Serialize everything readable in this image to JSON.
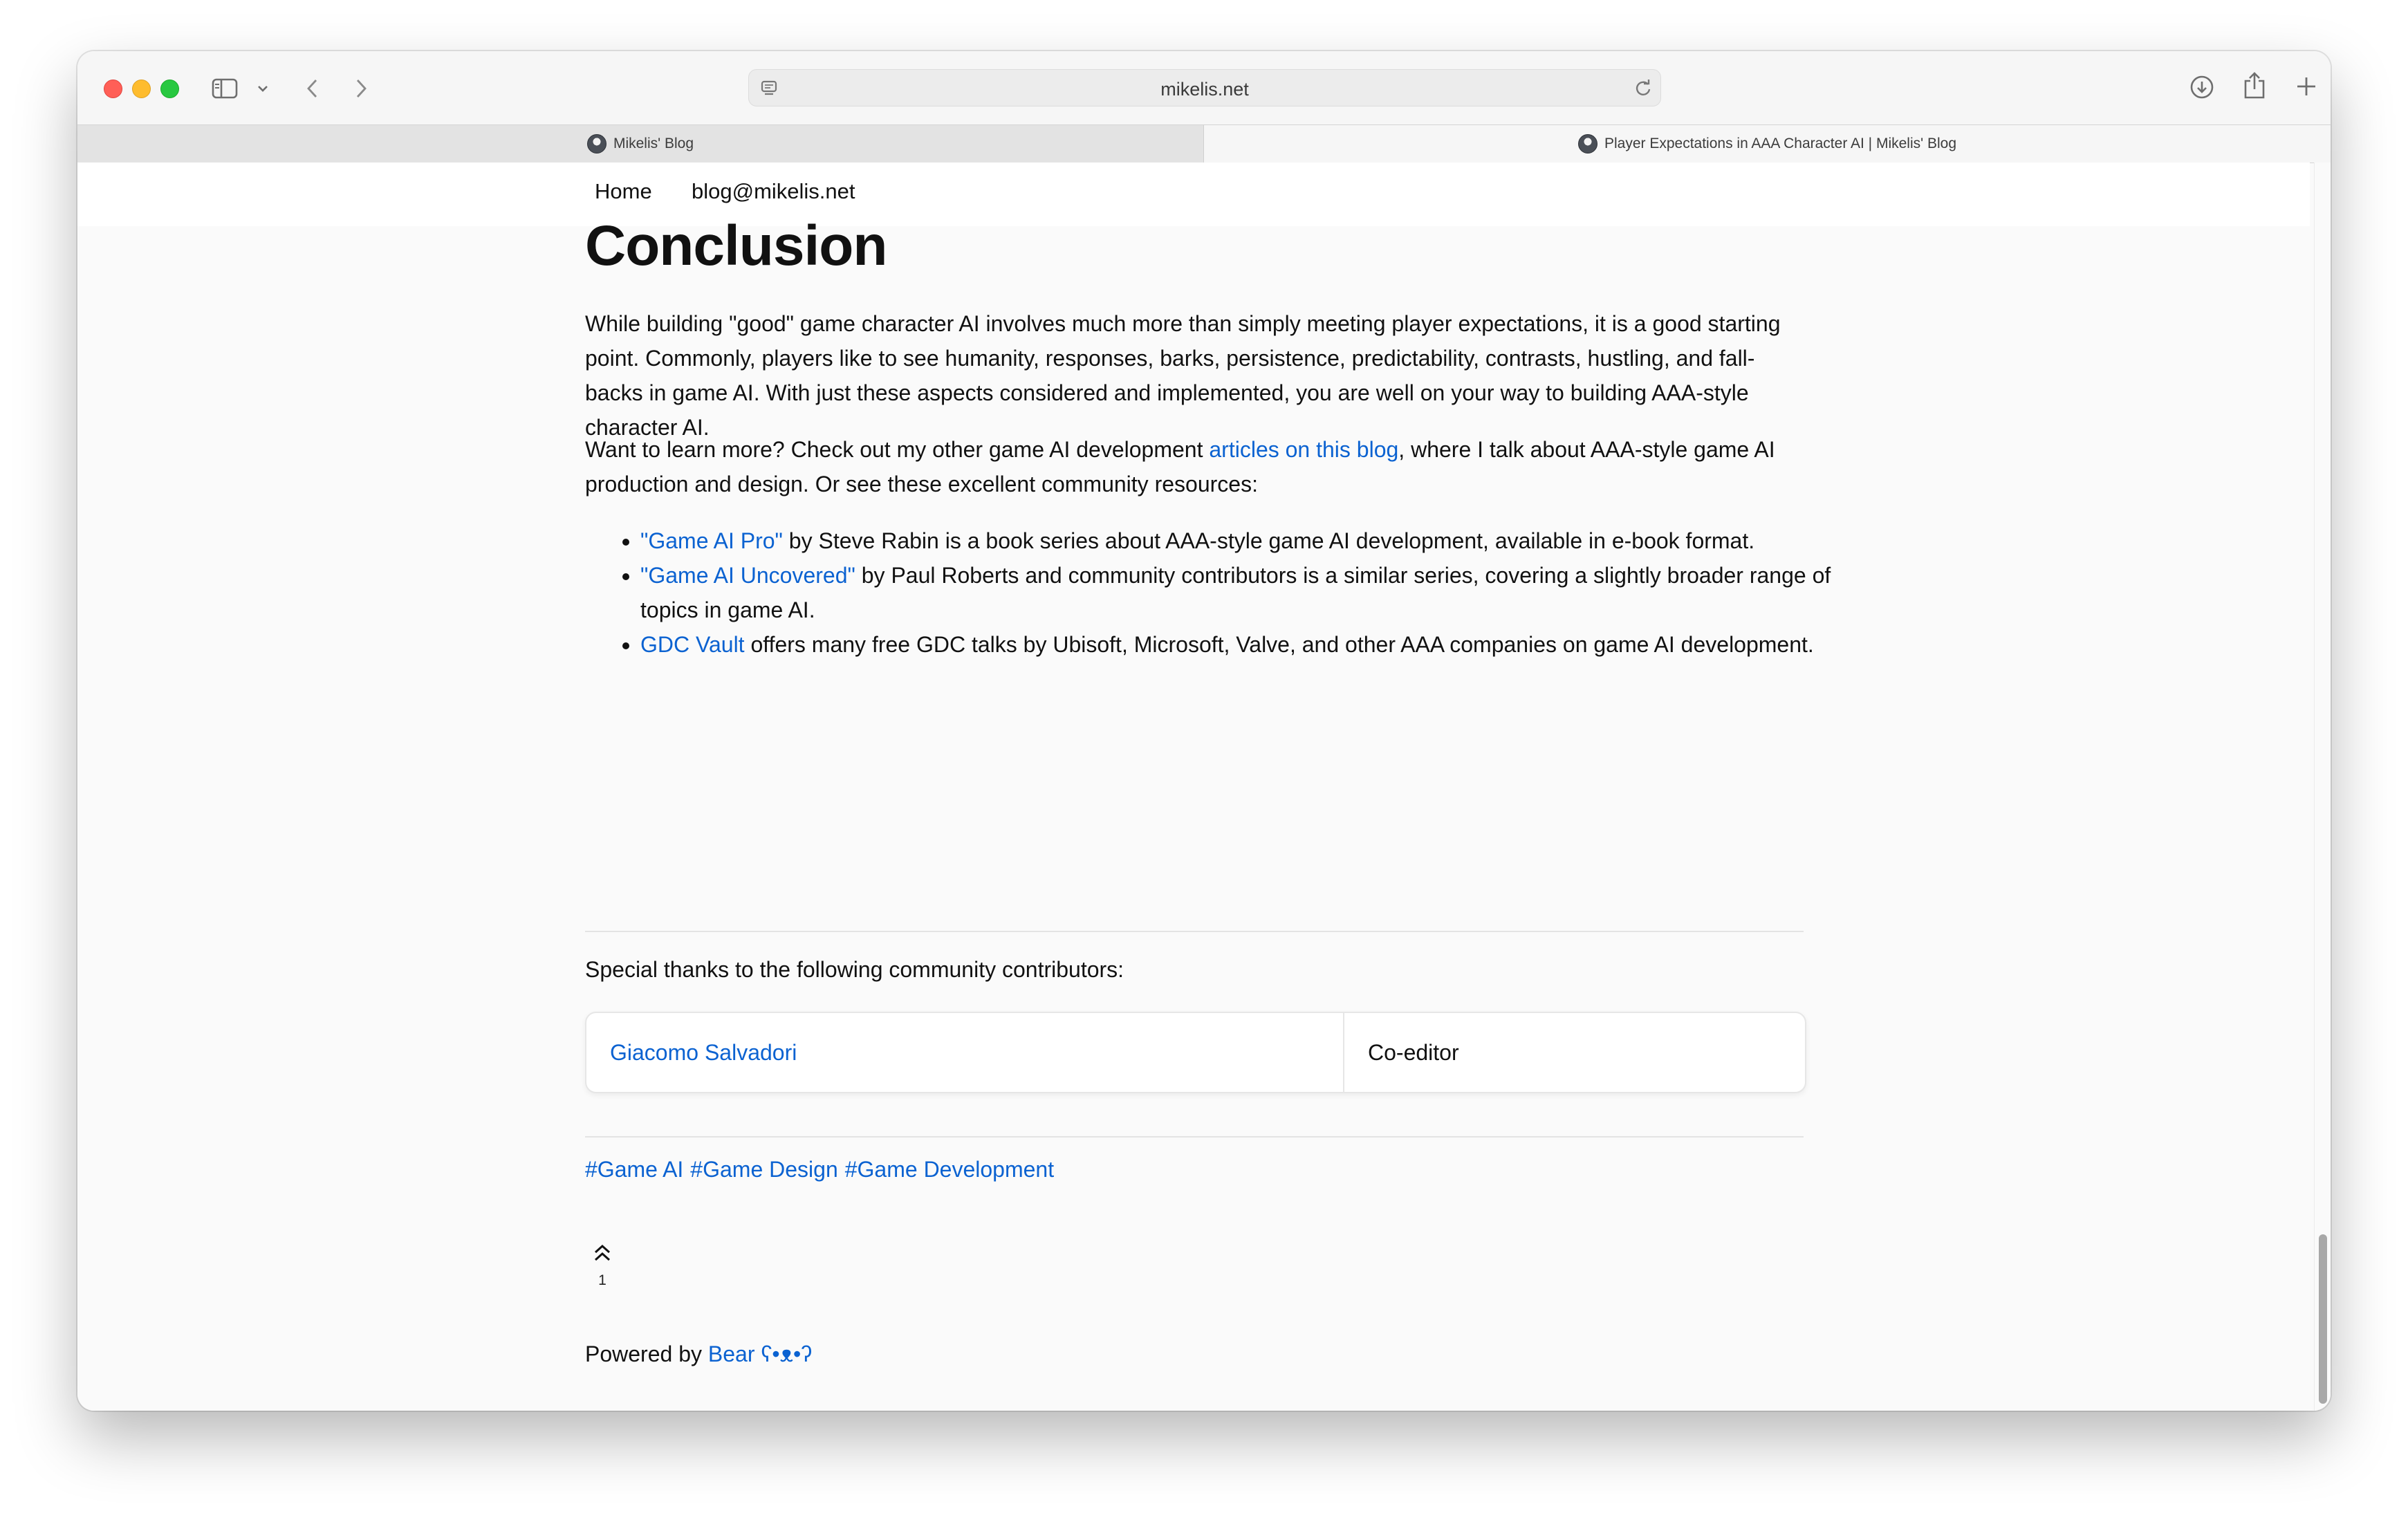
{
  "browser": {
    "url": "mikelis.net",
    "tabs": [
      {
        "label": "Mikelis' Blog"
      },
      {
        "label": "Player Expectations in AAA Character AI | Mikelis' Blog"
      }
    ]
  },
  "nav": {
    "items": [
      {
        "label": "Home"
      },
      {
        "label": "blog@mikelis.net"
      }
    ]
  },
  "article": {
    "title": "Conclusion",
    "paragraph1": "While building \"good\" game character AI involves much more than simply meeting player expectations, it is a good starting point. Commonly, players like to see humanity, responses, barks, persistence, predictability, contrasts, hustling, and fall-backs in game AI. With just these aspects considered and implemented, you are well on your way to building AAA-style character AI.",
    "paragraph2": {
      "before": "Want to learn more? Check out my other game AI development ",
      "link": "articles on this blog",
      "after": ", where I talk about AAA-style game AI production and design. Or see these excellent community resources:"
    },
    "resources": [
      {
        "link": "\"Game AI Pro\"",
        "text": " by Steve Rabin is a book series about AAA-style game AI development, available in e-book format."
      },
      {
        "link": "\"Game AI Uncovered\"",
        "text": " by Paul Roberts and community contributors is a similar series, covering a slightly broader range of topics in game AI."
      },
      {
        "link": "GDC Vault",
        "text": " offers many free GDC talks by Ubisoft, Microsoft, Valve, and other AAA companies on game AI development."
      }
    ],
    "thanks": "Special thanks to the following community contributors:",
    "contributors": [
      {
        "name": "Giacomo Salvadori",
        "role": "Co-editor"
      }
    ],
    "tags": [
      "#Game AI",
      "#Game Design",
      "#Game Development"
    ],
    "upvote_count": "1",
    "powered_by": "Powered by ",
    "bear_link": "Bear ʕ•ᴥ•ʔ"
  }
}
